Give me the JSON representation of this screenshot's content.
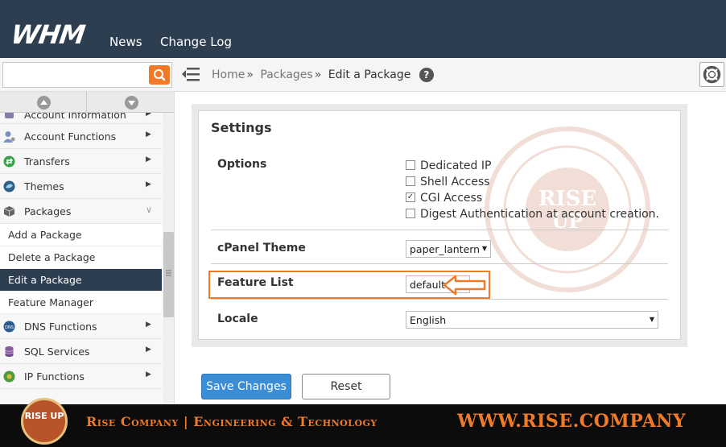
{
  "app": {
    "logo_text": "WHM"
  },
  "topnav": {
    "items": [
      "News",
      "Change Log"
    ]
  },
  "search": {
    "placeholder": ""
  },
  "breadcrumb": {
    "items": [
      "Home",
      "Packages",
      "Edit a Package"
    ],
    "separator": "»"
  },
  "sidebar": {
    "items": [
      {
        "label": "Account Information",
        "icon": "account-info-icon"
      },
      {
        "label": "Account Functions",
        "icon": "account-functions-icon"
      },
      {
        "label": "Transfers",
        "icon": "transfers-icon"
      },
      {
        "label": "Themes",
        "icon": "themes-icon"
      },
      {
        "label": "Packages",
        "icon": "packages-icon"
      }
    ],
    "sub_items": [
      "Add a Package",
      "Delete a Package",
      "Edit a Package",
      "Feature Manager"
    ],
    "active_sub_item": "Edit a Package",
    "items_after": [
      {
        "label": "DNS Functions",
        "icon": "dns-icon"
      },
      {
        "label": "SQL Services",
        "icon": "sql-icon"
      },
      {
        "label": "IP Functions",
        "icon": "ip-icon"
      }
    ]
  },
  "settings": {
    "title": "Settings",
    "options_label": "Options",
    "options": [
      {
        "label": "Dedicated IP",
        "checked": false
      },
      {
        "label": "Shell Access",
        "checked": false
      },
      {
        "label": "CGI Access",
        "checked": true
      },
      {
        "label": "Digest Authentication at account creation.",
        "checked": false
      }
    ],
    "cpanel_theme_label": "cPanel Theme",
    "cpanel_theme_value": "paper_lantern",
    "feature_list_label": "Feature List",
    "feature_list_value": "default",
    "locale_label": "Locale",
    "locale_value": "English"
  },
  "buttons": {
    "save": "Save Changes",
    "reset": "Reset"
  },
  "footer": {
    "company": "Rise Company | Engineering & Technology",
    "url": "WWW.RISE.COMPANY",
    "logo_text": "RISE UP"
  },
  "colors": {
    "topbar": "#2d3e50",
    "accent": "#f07a28",
    "primary_button": "#3b8ed6"
  }
}
